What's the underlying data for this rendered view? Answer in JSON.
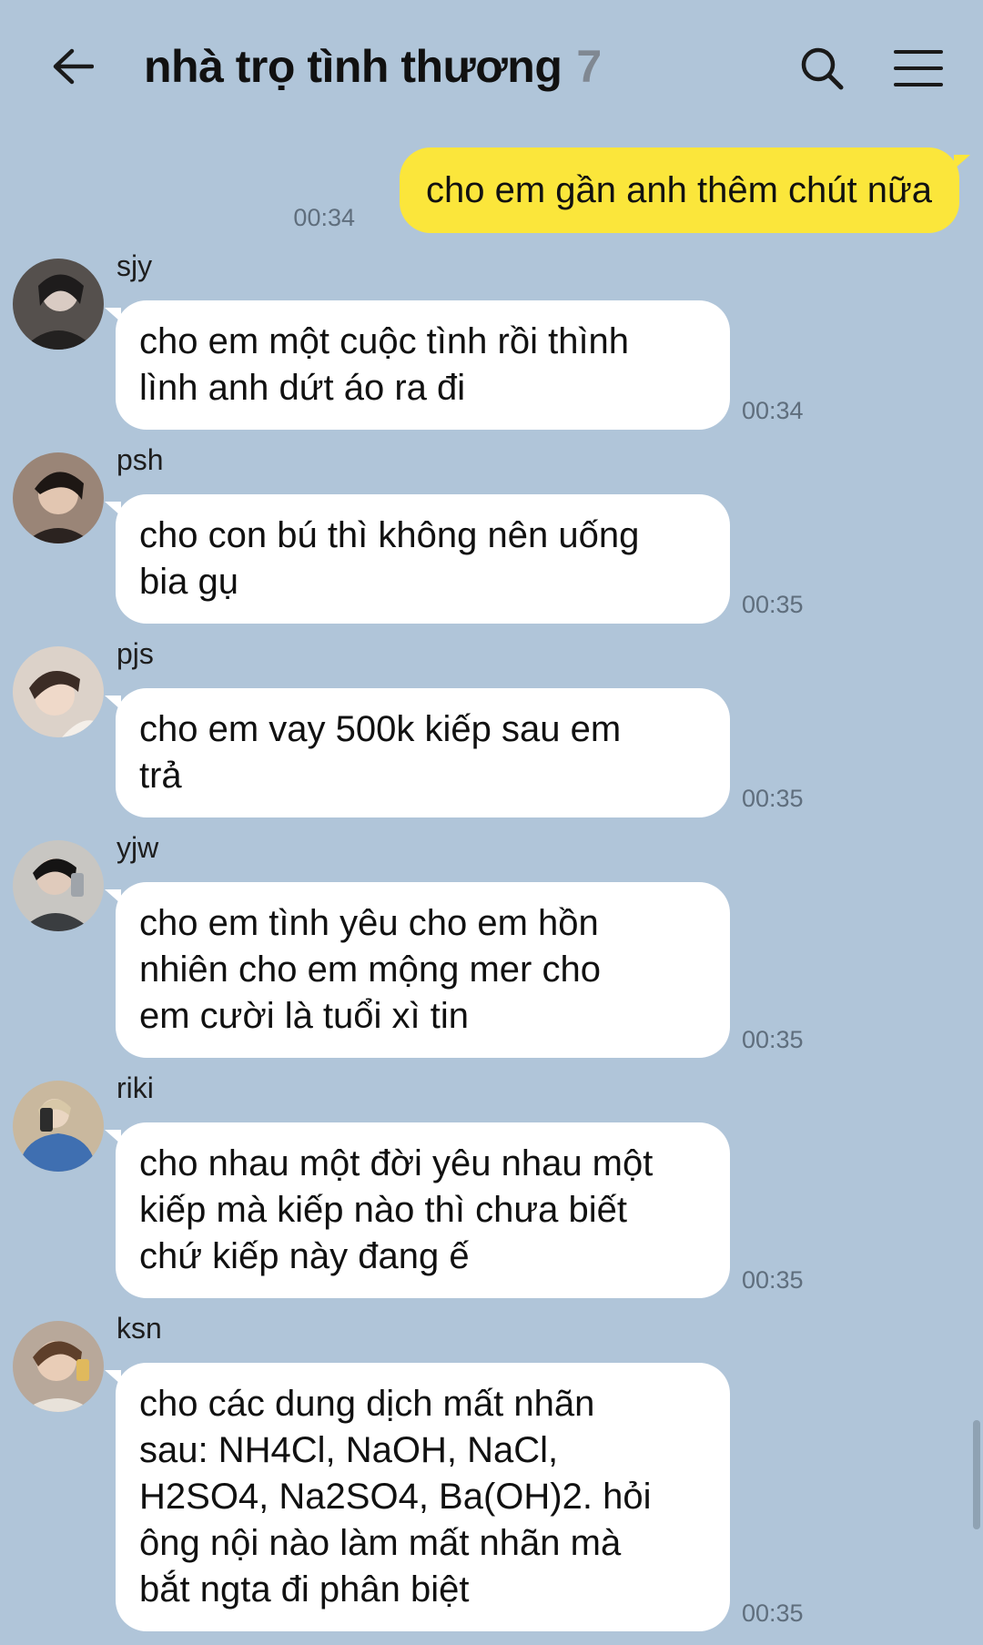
{
  "header": {
    "title": "nhà trọ tình thương",
    "member_count": "7",
    "back_icon": "arrow-left-icon",
    "search_icon": "search-icon",
    "menu_icon": "hamburger-menu-icon"
  },
  "colors": {
    "background": "#b0c5d9",
    "outgoing_bubble": "#fbe63b",
    "incoming_bubble": "#ffffff",
    "timestamp": "#5f6e7d"
  },
  "outgoing": {
    "text": "cho em gần anh thêm chút nữa",
    "time": "00:34"
  },
  "messages": [
    {
      "sender": "sjy",
      "lines": [
        "cho em một cuộc tình rồi thình",
        "lình anh dứt áo ra đi"
      ],
      "time": "00:34"
    },
    {
      "sender": "psh",
      "lines": [
        "cho con bú thì không nên uống",
        "bia gụ"
      ],
      "time": "00:35"
    },
    {
      "sender": "pjs",
      "lines": [
        "cho em vay 500k kiếp sau em",
        "trả"
      ],
      "time": "00:35"
    },
    {
      "sender": "yjw",
      "lines": [
        "cho em tình yêu cho em hồn",
        "nhiên cho em mộng mer cho",
        "em cười là tuổi xì tin"
      ],
      "time": "00:35"
    },
    {
      "sender": "riki",
      "lines": [
        "cho nhau một đời yêu nhau một",
        "kiếp mà kiếp nào thì chưa biết",
        "chứ kiếp này đang ế"
      ],
      "time": "00:35"
    },
    {
      "sender": "ksn",
      "lines": [
        "cho các dung dịch mất nhãn",
        "sau: NH4Cl, NaOH, NaCl,",
        "H2SO4, Na2SO4, Ba(OH)2. hỏi",
        "ông nội nào làm mất nhãn mà",
        "bắt ngta đi phân biệt"
      ],
      "time": "00:35"
    }
  ]
}
